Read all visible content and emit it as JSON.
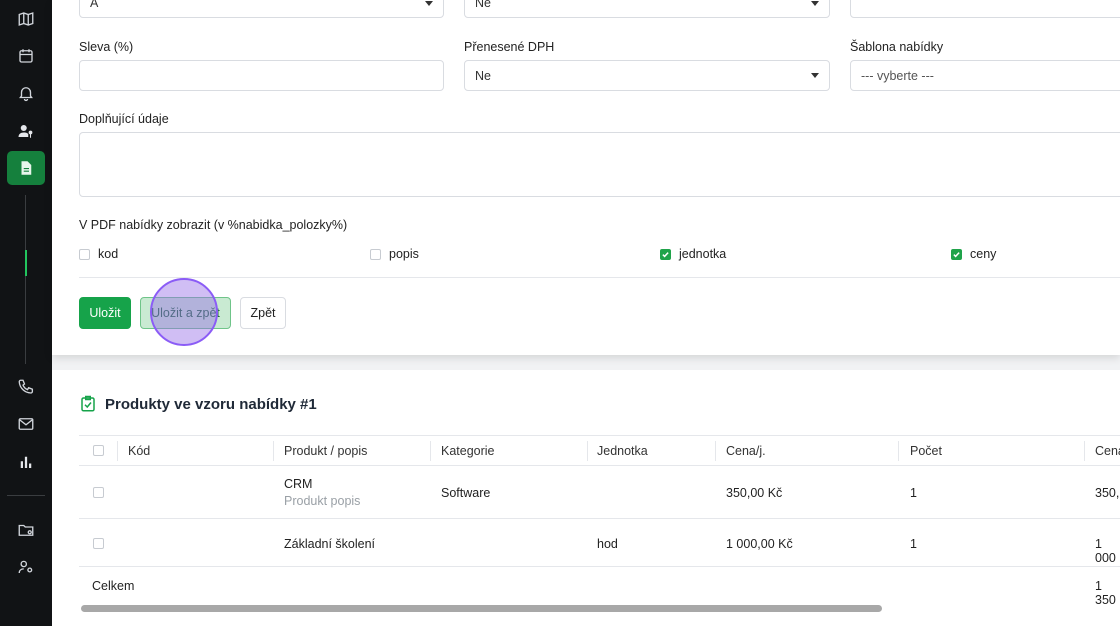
{
  "form": {
    "row0": {
      "col1_value": "A",
      "col2_value": "Ne"
    },
    "discount": {
      "label": "Sleva (%)",
      "value": ""
    },
    "vat": {
      "label": "Přenesené DPH",
      "value": "Ne"
    },
    "template": {
      "label": "Šablona nabídky",
      "value": "--- vyberte ---"
    },
    "extra": {
      "label": "Doplňující údaje",
      "value": ""
    },
    "pdf_show_label": "V PDF nabídky zobrazit (v %nabidka_polozky%)",
    "checkboxes": [
      {
        "label": "kod",
        "checked": false
      },
      {
        "label": "popis",
        "checked": false
      },
      {
        "label": "jednotka",
        "checked": true
      },
      {
        "label": "ceny",
        "checked": true
      }
    ],
    "buttons": {
      "save": "Uložit",
      "save_back": "Uložit a zpět",
      "back": "Zpět"
    }
  },
  "products": {
    "title": "Produkty ve vzoru nabídky #1",
    "columns": [
      "Kód",
      "Produkt / popis",
      "Kategorie",
      "Jednotka",
      "Cena/j.",
      "Počet",
      "Cena"
    ],
    "rows": [
      {
        "code": "",
        "product": "CRM",
        "description": "Produkt popis",
        "category": "Software",
        "unit": "",
        "unit_price": "350,00 Kč",
        "qty": "1",
        "price": "350,"
      },
      {
        "code": "",
        "product": "Základní školení",
        "description": "",
        "category": "",
        "unit": "hod",
        "unit_price": "1 000,00 Kč",
        "qty": "1",
        "price": "1 000"
      }
    ],
    "total_label": "Celkem",
    "total_value": "1 350"
  },
  "colors": {
    "accent": "#16a34a",
    "sidebar_bg": "#111315",
    "cursor": "#8b5cf6"
  },
  "icons": [
    "map-icon",
    "calendar-icon",
    "bell-icon",
    "user-key-icon",
    "document-icon",
    "phone-icon",
    "mail-icon",
    "chart-icon",
    "folder-icon",
    "user-settings-icon"
  ]
}
